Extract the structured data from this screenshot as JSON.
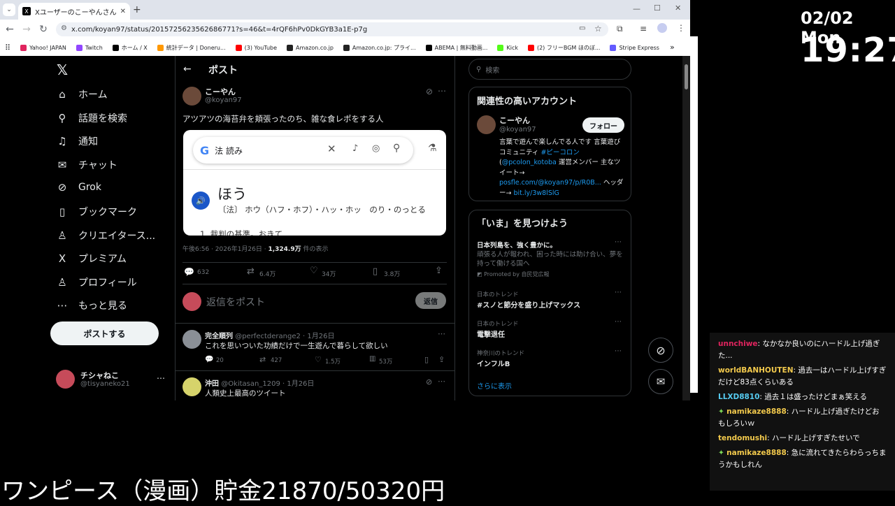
{
  "browser": {
    "tab_title": "Xユーザーのこーやんさん: 「アツアツの",
    "url": "x.com/koyan97/status/2015725623562686771?s=46&t=4rQF6hPv0DkGYB3a1E-p7g",
    "bookmarks": [
      "Yahoo! JAPAN",
      "Twitch",
      "ホーム / X",
      "統計データ | Doneru...",
      "(3) YouTube",
      "Amazon.co.jp",
      "Amazon.co.jp: プライ...",
      "ABEMA | 無料動画...",
      "Kick",
      "(2) フリーBGM ほのぼ...",
      "Stripe Express"
    ],
    "bookmark_colors": [
      "#e0245e",
      "#9146ff",
      "#000000",
      "#ff9800",
      "#ff0000",
      "#222222",
      "#222222",
      "#000000",
      "#53fc18",
      "#ff0000",
      "#635bff"
    ]
  },
  "sidebar": {
    "items": [
      {
        "label": "ホーム",
        "icon": "home-icon",
        "glyph": "⌂"
      },
      {
        "label": "話題を検索",
        "icon": "search-icon",
        "glyph": "⚲"
      },
      {
        "label": "通知",
        "icon": "bell-icon",
        "glyph": "♫"
      },
      {
        "label": "チャット",
        "icon": "mail-icon",
        "glyph": "✉"
      },
      {
        "label": "Grok",
        "icon": "grok-icon",
        "glyph": "⊘"
      },
      {
        "label": "ブックマーク",
        "icon": "bookmark-icon",
        "glyph": "▯"
      },
      {
        "label": "クリエイタース...",
        "icon": "creator-icon",
        "glyph": "♙"
      },
      {
        "label": "プレミアム",
        "icon": "x-icon",
        "glyph": "X"
      },
      {
        "label": "プロフィール",
        "icon": "profile-icon",
        "glyph": "♙"
      },
      {
        "label": "もっと見る",
        "icon": "more-icon",
        "glyph": "⋯"
      }
    ],
    "post_button": "ポストする",
    "account_name": "チシャねこ",
    "account_handle": "@tisyaneko21"
  },
  "post": {
    "header": "ポスト",
    "author": "こーやん",
    "handle": "@koyan97",
    "text": "アツアツの海苔弁を頬張ったのち、雑な食レポをする人",
    "embed": {
      "search_query": "法 読み",
      "reading": "ほう",
      "definition": "〔法〕 ホウ（ハフ・ホフ）・ハッ・ホッ　のり・のっとる",
      "cut_line": "1. 裁判の基準。おきて"
    },
    "meta_time": "午後6:56 · 2026年1月26日 · ",
    "views": "1,324.9万",
    "views_label": "件の表示",
    "stats": {
      "replies": "632",
      "reposts": "6.4万",
      "likes": "34万",
      "bookmarks": "3.8万"
    },
    "reply_placeholder": "返信をポスト",
    "reply_button": "返信"
  },
  "replies": [
    {
      "name": "完全順列",
      "handle": "@perfectderange2 · 1月26日",
      "text": "これを思いついた功績だけで一生遊んで暮らして欲しい",
      "replies": "20",
      "reposts": "427",
      "likes": "1.5万",
      "views": "53万"
    },
    {
      "name": "沖田",
      "handle": "@Okitasan_1209 · 1月26日",
      "text": "人類史上最高のツイート"
    }
  ],
  "right": {
    "search_placeholder": "検索",
    "related_title": "関連性の高いアカウント",
    "related_name": "こーやん",
    "related_handle": "@koyan97",
    "follow": "フォロー",
    "bio_lines": [
      "言葉で遊んで楽しんでる人です 言葉遊",
      "びコミュニティ ",
      "#ピーコロン",
      " (",
      "@pcolon_kotoba",
      " 運営メンバー 主なツ",
      "イート→",
      "posfle.com/@koyan97/p/R0B...",
      "ヘッダ",
      "ー→ ",
      "bit.ly/3w8lSlG"
    ],
    "trends_title": "「いま」を見つけよう",
    "promo_title": "日本列島を、強く豊かに。",
    "promo_text": "頑張る人が報われ、困った時には助け合い、夢を持って働ける国へ",
    "promo_by": "Promoted by 自民党広報",
    "trends": [
      {
        "context": "日本のトレンド",
        "name": "#スノと節分を盛り上げマックス"
      },
      {
        "context": "日本のトレンド",
        "name": "電撃退任"
      },
      {
        "context": "神奈川のトレンド",
        "name": "インフルB"
      }
    ],
    "show_more": "さらに表示"
  },
  "overlay": {
    "date": "02/02 Mon",
    "time": "19:27",
    "savings": "ワンピース（漫画）貯金21870/50320円"
  },
  "chat": [
    {
      "user": "unnchiwe",
      "color": "#e0245e",
      "text": "なかなか良いのにハードル上げ過ぎた...",
      "badge": false
    },
    {
      "user": "worldBANHOUTEN",
      "color": "#f2c94c",
      "text": "過去一はハードル上げすぎだけど83点くらいある",
      "badge": false
    },
    {
      "user": "LLXD8810",
      "color": "#56ccf2",
      "text": "過去１は盛ったけどまぁ笑える",
      "badge": false
    },
    {
      "user": "namikaze8888",
      "color": "#f2c94c",
      "text": "ハードル上げ過ぎたけどおもしろいｗ",
      "badge": true
    },
    {
      "user": "tendomushi",
      "color": "#f2c94c",
      "text": "ハードル上げすぎたせいで",
      "badge": false
    },
    {
      "user": "namikaze8888",
      "color": "#f2c94c",
      "text": "急に流れてきたらわらっちまうかもしれん",
      "badge": true
    }
  ]
}
